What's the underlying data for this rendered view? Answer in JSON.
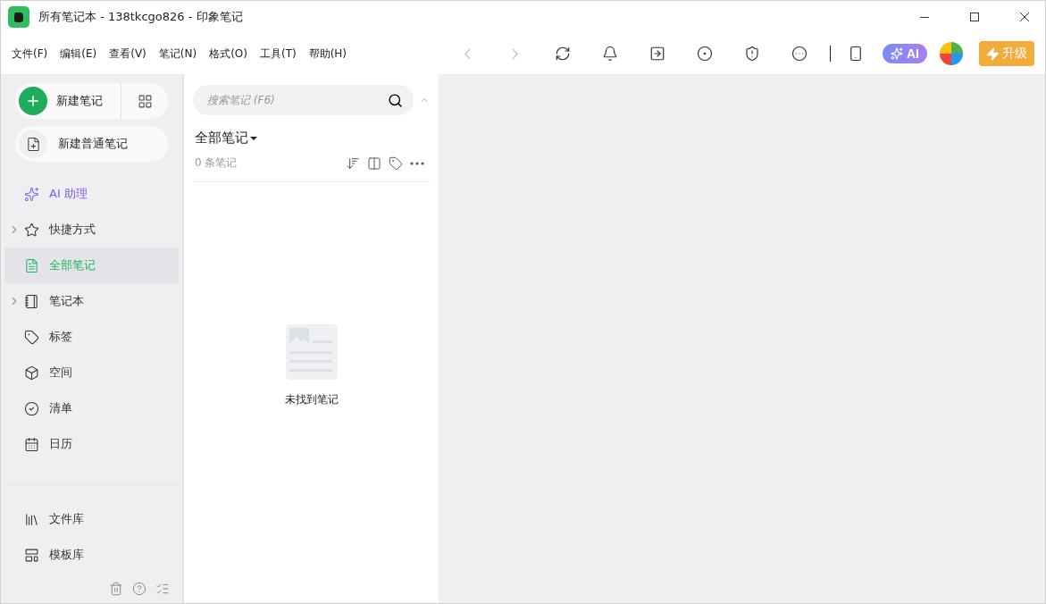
{
  "window": {
    "title": "所有笔记本 - 138tkcgo826 - 印象笔记"
  },
  "menu": [
    "文件(F)",
    "编辑(E)",
    "查看(V)",
    "笔记(N)",
    "格式(O)",
    "工具(T)",
    "帮助(H)"
  ],
  "toolbar": {
    "back": {
      "disabled": true
    },
    "forward": {
      "disabled": true
    },
    "ai_label": "AI",
    "upgrade_label": "升级"
  },
  "sidebar": {
    "new_note": "新建笔记",
    "new_plain_note": "新建普通笔记",
    "items": [
      {
        "label": "AI 助理",
        "kind": "ai",
        "selected": false,
        "expandable": false
      },
      {
        "label": "快捷方式",
        "kind": "nav",
        "selected": false,
        "expandable": true
      },
      {
        "label": "全部笔记",
        "kind": "nav",
        "selected": true,
        "expandable": false
      },
      {
        "label": "笔记本",
        "kind": "nav",
        "selected": false,
        "expandable": true
      },
      {
        "label": "标签",
        "kind": "nav",
        "selected": false,
        "expandable": false
      },
      {
        "label": "空间",
        "kind": "nav",
        "selected": false,
        "expandable": false
      },
      {
        "label": "清单",
        "kind": "nav",
        "selected": false,
        "expandable": false
      },
      {
        "label": "日历",
        "kind": "nav",
        "selected": false,
        "expandable": false
      }
    ],
    "bottom_items": [
      {
        "label": "文件库"
      },
      {
        "label": "模板库"
      }
    ]
  },
  "note_list": {
    "search_placeholder": "搜索笔记 (F6)",
    "heading": "全部笔记",
    "count": "0 条笔记",
    "empty_text": "未找到笔记"
  }
}
